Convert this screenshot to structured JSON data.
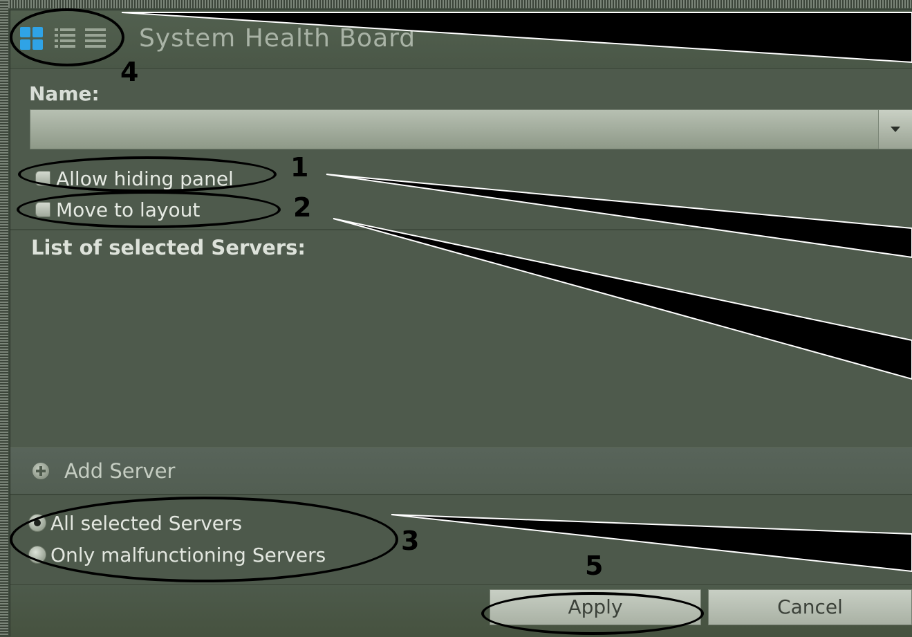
{
  "window": {
    "title": "System Health Board"
  },
  "view_icons": [
    "tiles-view-icon",
    "list-view-icon",
    "rows-view-icon"
  ],
  "form": {
    "name_label": "Name:",
    "name_value": "",
    "allow_hiding_panel": {
      "label": "Allow hiding panel",
      "checked": false
    },
    "move_to_layout": {
      "label": "Move to layout",
      "checked": false
    },
    "servers_label": "List of selected Servers:",
    "servers": [],
    "add_server_label": "Add Server",
    "filter_options": [
      {
        "label": "All selected Servers",
        "selected": true
      },
      {
        "label": "Only malfunctioning Servers",
        "selected": false
      }
    ]
  },
  "buttons": {
    "apply": "Apply",
    "cancel": "Cancel"
  },
  "annotations": [
    "1",
    "2",
    "3",
    "4",
    "5"
  ],
  "colors": {
    "accent_icon": "#2fa3e6",
    "panel_bg": "#4e5a4c",
    "callout": "#000000"
  }
}
